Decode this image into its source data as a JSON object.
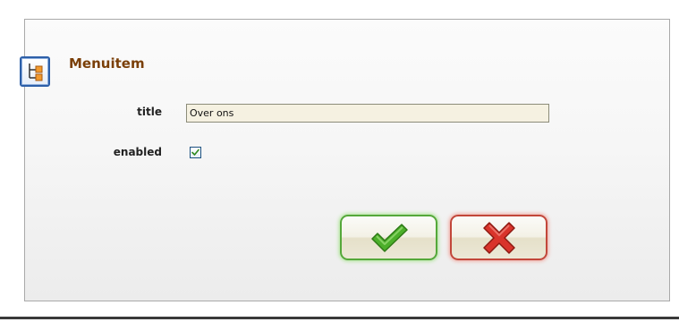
{
  "dialog": {
    "title": "Menuitem",
    "icon": "menu-tree-icon"
  },
  "form": {
    "title_label": "title",
    "title_value": "Over ons",
    "enabled_label": "enabled",
    "enabled_checked": true
  },
  "buttons": {
    "ok_icon": "checkmark-icon",
    "cancel_icon": "cross-icon"
  },
  "colors": {
    "title_text": "#7a3f08",
    "input_background": "#f5f1e1",
    "ok_border": "#55a83a",
    "cancel_border": "#c2473a",
    "checkmark": "#4caf2a",
    "cross": "#d9342b"
  }
}
